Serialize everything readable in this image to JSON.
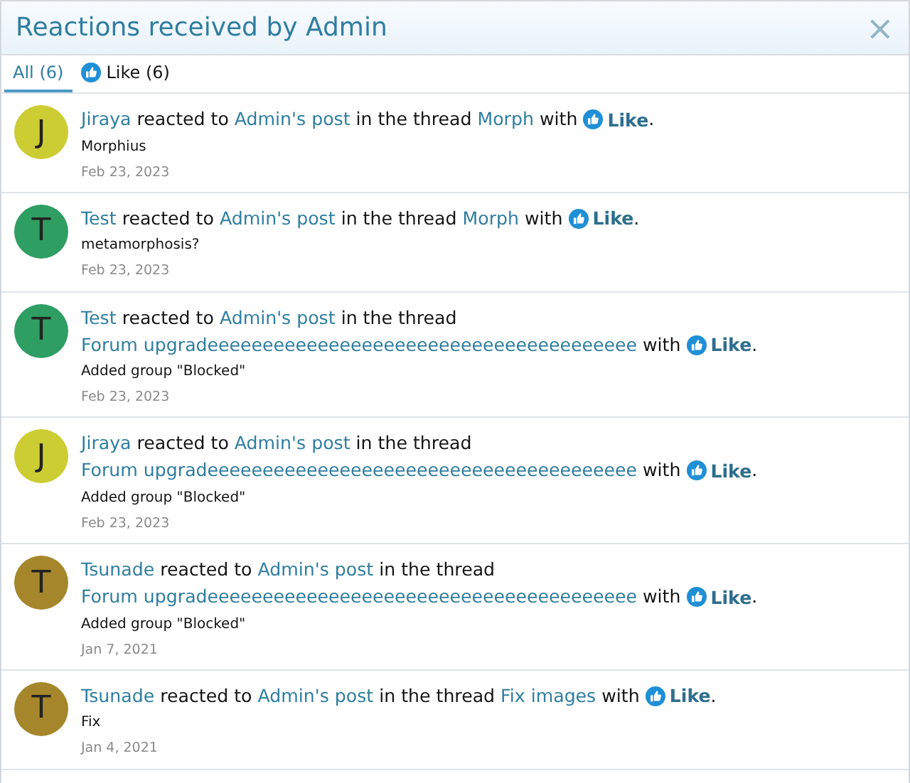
{
  "overlay": {
    "title": "Reactions received by Admin",
    "close": "×"
  },
  "tabs": [
    {
      "label": "All (6)",
      "kind": "all",
      "selected": true
    },
    {
      "label": "Like (6)",
      "kind": "reaction",
      "selected": false
    }
  ],
  "reactions": [
    {
      "user": "Jiraya",
      "initial": "J",
      "color": "#cccc33",
      "verb": "reacted to",
      "post": "Admin's post",
      "connector": "in the thread",
      "thread": "Morph",
      "with": "with",
      "reaction": "Like",
      "end": ".",
      "snippet": "Morphius",
      "date": "Feb 23, 2023"
    },
    {
      "user": "Test",
      "initial": "T",
      "color": "#2e9e62",
      "verb": "reacted to",
      "post": "Admin's post",
      "connector": "in the thread",
      "thread": "Morph",
      "with": "with",
      "reaction": "Like",
      "end": ".",
      "snippet": "metamorphosis?",
      "date": "Feb 23, 2023"
    },
    {
      "user": "Test",
      "initial": "T",
      "color": "#2e9e62",
      "verb": "reacted to",
      "post": "Admin's post",
      "connector": "in the thread",
      "thread": "Forum upgradeeeeeeeeeeeeeeeeeeeeeeeeeeeeeeeeeeeeeee",
      "with": "with",
      "reaction": "Like",
      "end": ".",
      "snippet": "Added group \"Blocked\"",
      "date": "Feb 23, 2023"
    },
    {
      "user": "Jiraya",
      "initial": "J",
      "color": "#cccc33",
      "verb": "reacted to",
      "post": "Admin's post",
      "connector": "in the thread",
      "thread": "Forum upgradeeeeeeeeeeeeeeeeeeeeeeeeeeeeeeeeeeeeeee",
      "with": "with",
      "reaction": "Like",
      "end": ".",
      "snippet": "Added group \"Blocked\"",
      "date": "Feb 23, 2023"
    },
    {
      "user": "Tsunade",
      "initial": "T",
      "color": "#a6862a",
      "verb": "reacted to",
      "post": "Admin's post",
      "connector": "in the thread",
      "thread": "Forum upgradeeeeeeeeeeeeeeeeeeeeeeeeeeeeeeeeeeeeeee",
      "with": "with",
      "reaction": "Like",
      "end": ".",
      "snippet": "Added group \"Blocked\"",
      "date": "Jan 7, 2021"
    },
    {
      "user": "Tsunade",
      "initial": "T",
      "color": "#a6862a",
      "verb": "reacted to",
      "post": "Admin's post",
      "connector": "in the thread",
      "thread": "Fix images",
      "with": "with",
      "reaction": "Like",
      "end": ".",
      "snippet": "Fix",
      "date": "Jan 4, 2021"
    }
  ]
}
